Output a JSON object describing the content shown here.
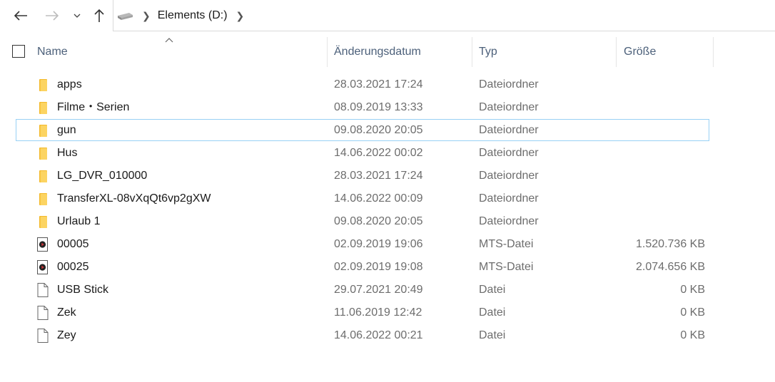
{
  "breadcrumb": {
    "location": "Elements (D:)"
  },
  "columns": {
    "name": "Name",
    "modified": "Änderungsdatum",
    "type": "Typ",
    "size": "Größe"
  },
  "rows": [
    {
      "name": "apps",
      "date": "28.03.2021 17:24",
      "type": "Dateiordner",
      "size": "",
      "icon": "folder-icon"
    },
    {
      "name": "Filme・Serien",
      "date": "08.09.2019 13:33",
      "type": "Dateiordner",
      "size": "",
      "icon": "folder-icon"
    },
    {
      "name": "gun",
      "date": "09.08.2020 20:05",
      "type": "Dateiordner",
      "size": "",
      "icon": "folder-icon"
    },
    {
      "name": "Hus",
      "date": "14.06.2022 00:02",
      "type": "Dateiordner",
      "size": "",
      "icon": "folder-icon"
    },
    {
      "name": "LG_DVR_010000",
      "date": "28.03.2021 17:24",
      "type": "Dateiordner",
      "size": "",
      "icon": "folder-icon"
    },
    {
      "name": "TransferXL-08vXqQt6vp2gXW",
      "date": "14.06.2022 00:09",
      "type": "Dateiordner",
      "size": "",
      "icon": "folder-icon"
    },
    {
      "name": "Urlaub 1",
      "date": "09.08.2020 20:05",
      "type": "Dateiordner",
      "size": "",
      "icon": "folder-icon"
    },
    {
      "name": "00005",
      "date": "02.09.2019 19:06",
      "type": "MTS-Datei",
      "size": "1.520.736 KB",
      "icon": "video-file-icon"
    },
    {
      "name": "00025",
      "date": "02.09.2019 19:08",
      "type": "MTS-Datei",
      "size": "2.074.656 KB",
      "icon": "video-file-icon"
    },
    {
      "name": "USB Stick",
      "date": "29.07.2021 20:49",
      "type": "Datei",
      "size": "0 KB",
      "icon": "file-icon"
    },
    {
      "name": "Zek",
      "date": "11.06.2019 12:42",
      "type": "Datei",
      "size": "0 KB",
      "icon": "file-icon"
    },
    {
      "name": "Zey",
      "date": "14.06.2022 00:21",
      "type": "Datei",
      "size": "0 KB",
      "icon": "file-icon"
    }
  ],
  "colors": {
    "folder": "#f8c846",
    "header_text": "#4c607a",
    "focus_border": "#99d1f5"
  }
}
